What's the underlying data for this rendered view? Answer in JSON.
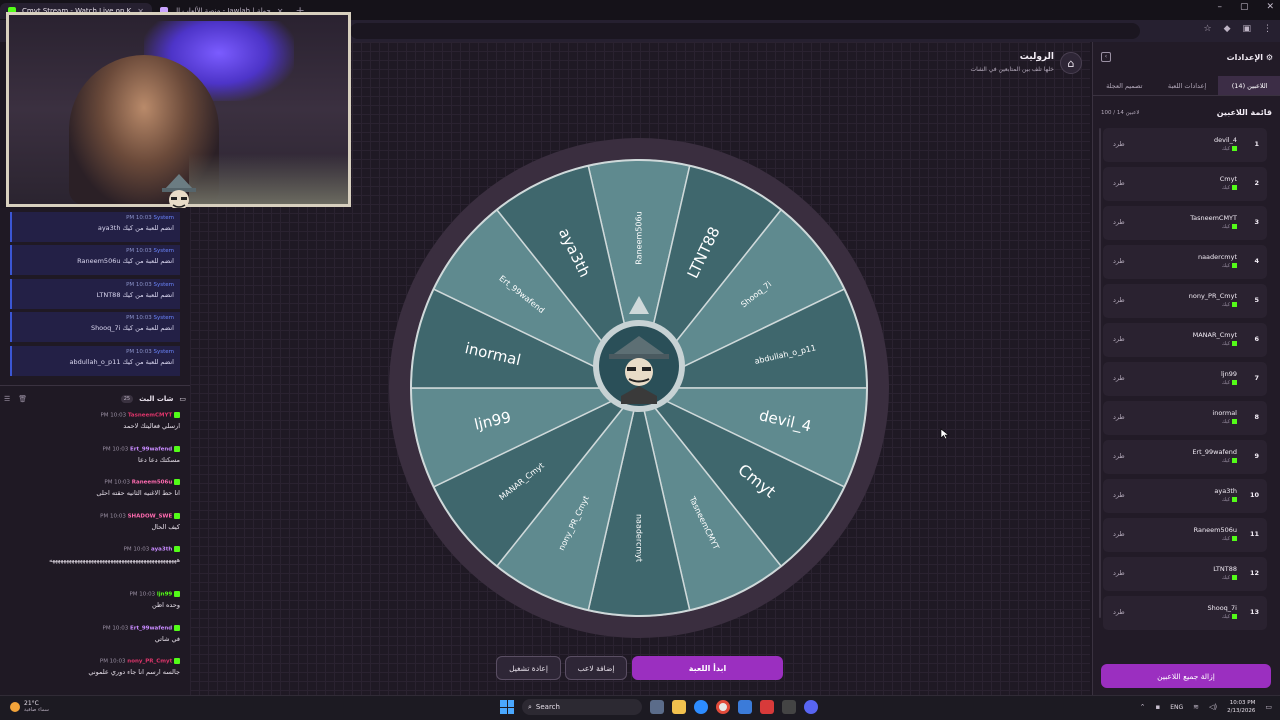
{
  "browser": {
    "tabs": [
      {
        "label": "Cmyt Stream - Watch Live on K"
      },
      {
        "label": "منصة الألعاب الـ - Jawlah | جولة"
      }
    ],
    "new_tab": "+",
    "window_controls": [
      "–",
      "▢",
      "✕"
    ]
  },
  "system_messages": [
    {
      "time": "PM 10:03",
      "sender": "System",
      "text": "aya3th انضم للعبة من كيك"
    },
    {
      "time": "PM 10:03",
      "sender": "System",
      "text": "Raneem506u انضم للعبة من كيك"
    },
    {
      "time": "PM 10:03",
      "sender": "System",
      "text": "LTNT88 انضم للعبة من كيك"
    },
    {
      "time": "PM 10:03",
      "sender": "System",
      "text": "Shooq_7i انضم للعبة من كيك"
    },
    {
      "time": "PM 10:03",
      "sender": "System",
      "text": "abdullah_o_p11 انضم للعبة من كيك"
    }
  ],
  "chat": {
    "title": "شات البث",
    "count": "25",
    "messages": [
      {
        "time": "PM 10:03",
        "name": "TasneemCMYT",
        "color": "#e0356b",
        "text": "ارسلي فعاليتك لاحمد"
      },
      {
        "time": "PM 10:03",
        "name": "Ert_99wafend",
        "color": "#c88bff",
        "text": "مسكتك دعا دعا"
      },
      {
        "time": "PM 10:03",
        "name": "Raneem506u",
        "color": "#ff6bb0",
        "text": "انا حط الاغنيه الثانيه حقته احلى"
      },
      {
        "time": "PM 10:03",
        "name": "SHADOW_SWE",
        "color": "#ff6bb0",
        "text": "كيف الحال"
      },
      {
        "time": "PM 10:03",
        "name": "aya3th",
        "color": "#c88bff",
        "text": "ههههههههههههههههههههههههههههههههههههههههههههههه"
      },
      {
        "time": "PM 10:03",
        "name": "ljn99",
        "color": "#53fc18",
        "text": "وحده اظن"
      },
      {
        "time": "PM 10:03",
        "name": "Ert_99wafend",
        "color": "#c88bff",
        "text": "في شاتي"
      },
      {
        "time": "PM 10:03",
        "name": "nony_PR_Cmyt",
        "color": "#e0356b",
        "text": "جالسه ارسم انا جاء دوري علموني"
      }
    ]
  },
  "game": {
    "title": "الروليت",
    "subtitle": "خلها تلف بين المتابعين في الشات",
    "wheel_segments": [
      "Raneem506u",
      "LTNT88",
      "Shooq_7i",
      "abdullah_o_p11",
      "devil_4",
      "Cmyt",
      "TasneemCMYT",
      "naadercmyt",
      "nony_PR_Cmyt",
      "MANAR_Cmyt",
      "ljn99",
      "inormal",
      "Ert_99wafend",
      "aya3th"
    ],
    "buttons": {
      "start": "ابدأ اللعبة",
      "add_player": "إضافة لاعب",
      "replay": "إعادة تشغيل"
    },
    "colors": {
      "wheel_light": "#5f8a8f",
      "wheel_dark": "#3f676d",
      "wheel_rim": "#3a2e3f",
      "accent": "#9b2fc0"
    }
  },
  "settings": {
    "title": "الإعدادات",
    "tabs": [
      {
        "label": "اللاعبين (14)"
      },
      {
        "label": "إعدادات اللعبة"
      },
      {
        "label": "تصميم العجلة"
      }
    ],
    "list_title": "قائمة اللاعبين",
    "count": "100 / 14 لاعبين",
    "platform_label": "كيك",
    "kick_label": "طرد",
    "players": [
      {
        "num": "1",
        "name": "devil_4"
      },
      {
        "num": "2",
        "name": "Cmyt"
      },
      {
        "num": "3",
        "name": "TasneemCMYT"
      },
      {
        "num": "4",
        "name": "naadercmyt"
      },
      {
        "num": "5",
        "name": "nony_PR_Cmyt"
      },
      {
        "num": "6",
        "name": "MANAR_Cmyt"
      },
      {
        "num": "7",
        "name": "ljn99"
      },
      {
        "num": "8",
        "name": "inormal"
      },
      {
        "num": "9",
        "name": "Ert_99wafend"
      },
      {
        "num": "10",
        "name": "aya3th"
      },
      {
        "num": "11",
        "name": "Raneem506u"
      },
      {
        "num": "12",
        "name": "LTNT88"
      },
      {
        "num": "13",
        "name": "Shooq_7i"
      }
    ],
    "remove_all": "إزالة جميع اللاعبين"
  },
  "taskbar": {
    "temp": "21°C",
    "weather": "سماء صافية",
    "search": "Search",
    "lang": "ENG",
    "time": "10:03 PM",
    "date": "2/13/2026"
  }
}
